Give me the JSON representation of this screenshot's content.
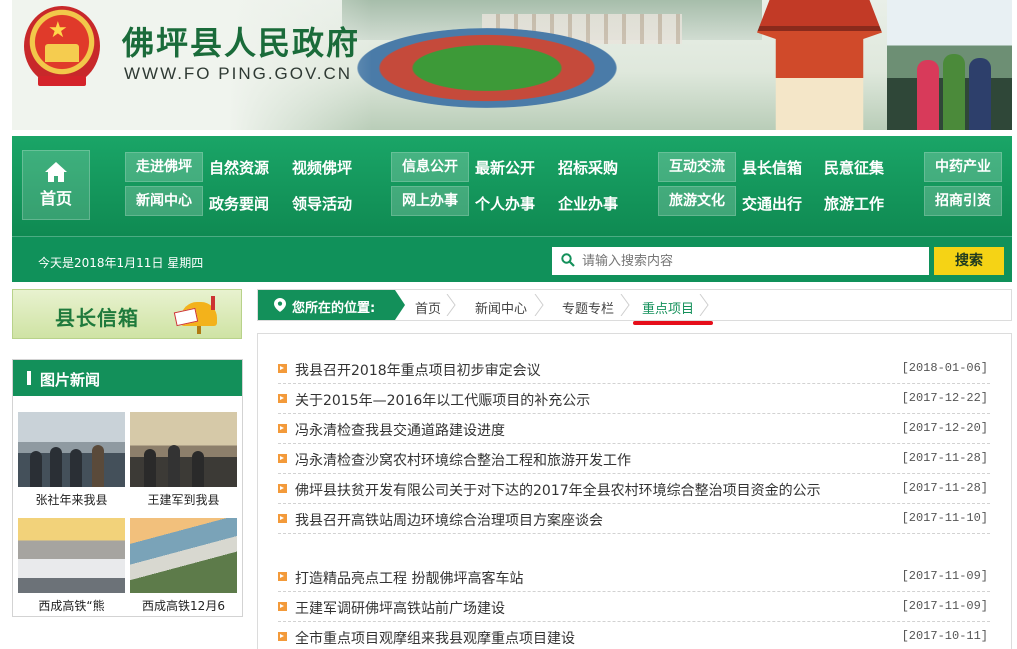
{
  "header": {
    "site_title": "佛坪县人民政府",
    "site_url": "WWW.FO PING.GOV.CN"
  },
  "nav": {
    "home_label": "首页",
    "groups": [
      {
        "boxed": [
          "走进佛坪",
          "新闻中心"
        ],
        "links": [
          "自然资源",
          "视频佛坪",
          "政务要闻",
          "领导活动"
        ]
      },
      {
        "boxed": [
          "信息公开",
          "网上办事"
        ],
        "links": [
          "最新公开",
          "招标采购",
          "个人办事",
          "企业办事"
        ]
      },
      {
        "boxed": [
          "互动交流",
          "旅游文化"
        ],
        "links": [
          "县长信箱",
          "民意征集",
          "交通出行",
          "旅游工作"
        ]
      },
      {
        "boxed": [
          "中药产业",
          "招商引资"
        ],
        "links": []
      }
    ],
    "date_text": "今天是2018年1月11日 星期四",
    "search_placeholder": "请输入搜索内容",
    "search_button": "搜索"
  },
  "sidebar": {
    "mayor_mailbox": "县长信箱",
    "pic_news_title": "图片新闻",
    "pic_news": [
      {
        "caption": "张社年来我县"
      },
      {
        "caption": "王建军到我县"
      },
      {
        "caption": "西成高铁“熊"
      },
      {
        "caption": "西成高铁12月6"
      }
    ]
  },
  "breadcrumb": {
    "label": "您所在的位置:",
    "items": [
      "首页",
      "新闻中心",
      "专题专栏",
      "重点项目"
    ]
  },
  "articles": [
    {
      "title": "我县召开2018年重点项目初步审定会议",
      "date": "[2018-01-06]"
    },
    {
      "title": "关于2015年—2016年以工代赈项目的补充公示",
      "date": "[2017-12-22]"
    },
    {
      "title": "冯永清检查我县交通道路建设进度",
      "date": "[2017-12-20]"
    },
    {
      "title": "冯永清检查沙窝农村环境综合整治工程和旅游开发工作",
      "date": "[2017-11-28]"
    },
    {
      "title": "佛坪县扶贫开发有限公司关于对下达的2017年全县农村环境综合整治项目资金的公示",
      "date": "[2017-11-28]"
    },
    {
      "title": "我县召开高铁站周边环境综合治理项目方案座谈会",
      "date": "[2017-11-10]"
    },
    {
      "title": "打造精品亮点工程 扮靓佛坪高客车站",
      "date": "[2017-11-09]"
    },
    {
      "title": "王建军调研佛坪高铁站前广场建设",
      "date": "[2017-11-09]"
    },
    {
      "title": "全市重点项目观摩组来我县观摩重点项目建设",
      "date": "[2017-10-11]"
    }
  ],
  "colors": {
    "brand_green": "#13905a",
    "search_yellow": "#f5d315",
    "highlight_red": "#e60e1a",
    "bullet_orange": "#f39a3a"
  }
}
